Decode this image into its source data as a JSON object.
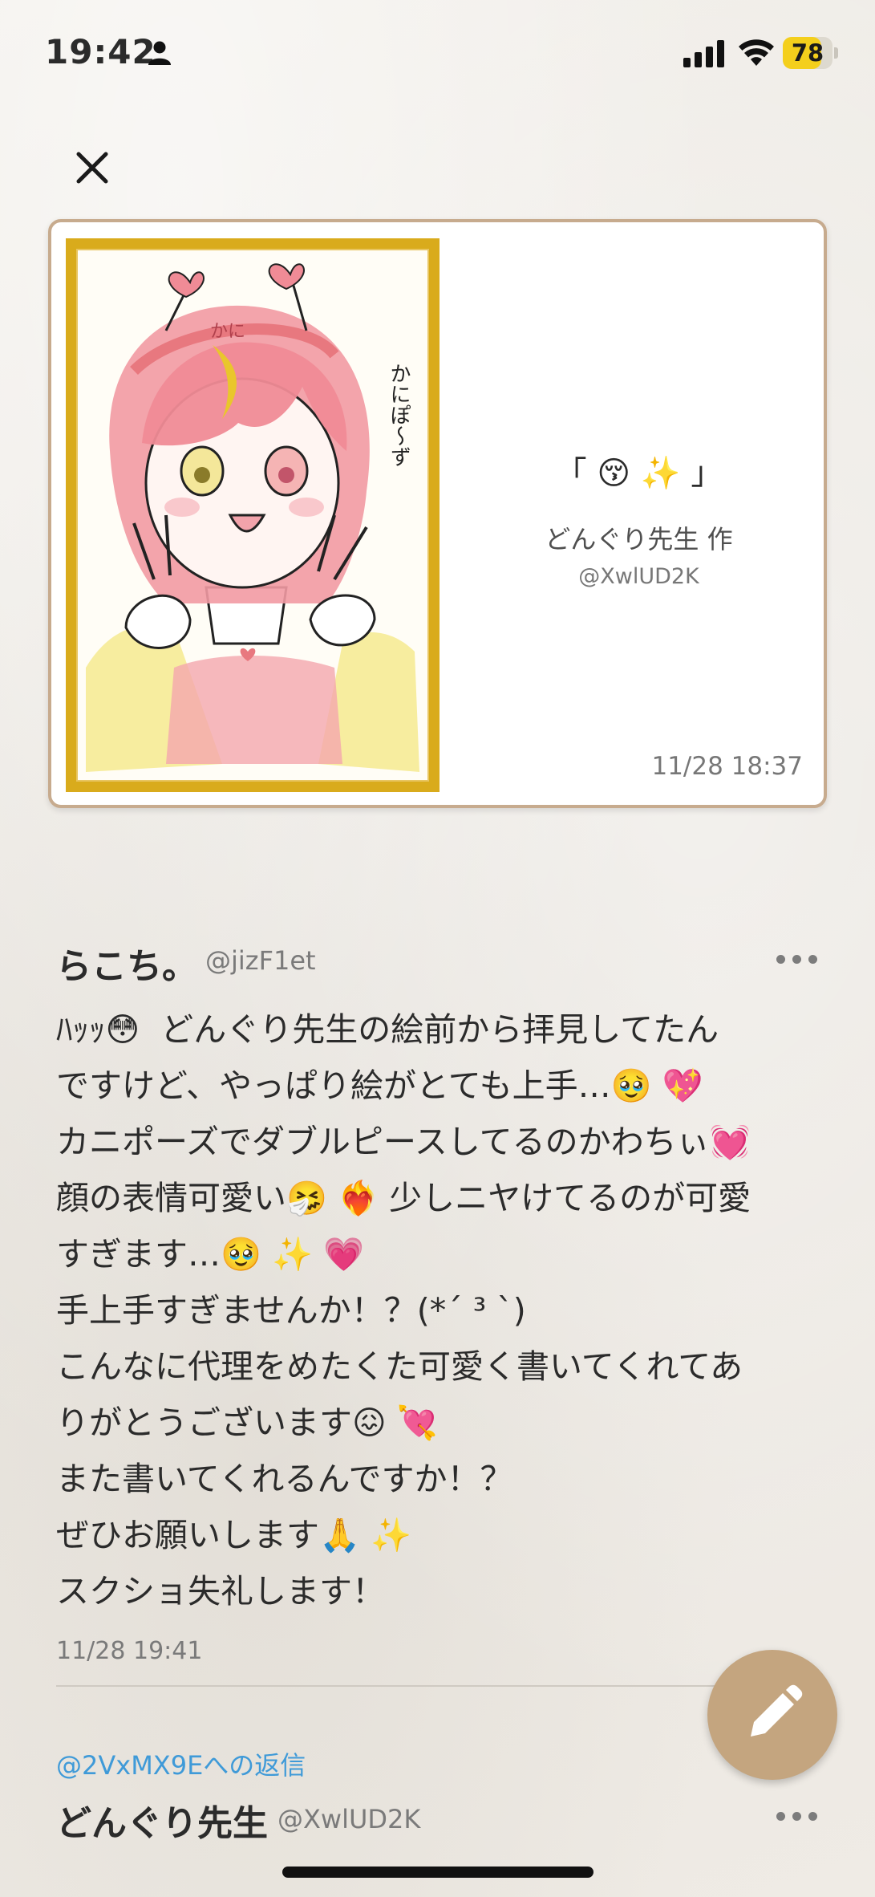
{
  "status_bar": {
    "time": "19:42",
    "battery": "78",
    "battery_level": 0.78,
    "battery_color": "#f4cf1c"
  },
  "card": {
    "title": "「 😚 ✨ 」",
    "author": "どんぐり先生 作",
    "handle": "@XwlUD2K",
    "date": "11/28 18:37",
    "artwork_caption": "かにぽ〜ず",
    "artwork_headband": "かに",
    "frame_color": "#d9ab1c",
    "border_color": "#c7ab8e"
  },
  "post": {
    "name": "らこち。",
    "handle": "@jizF1et",
    "lines": [
      "ﾊｯｯ😳 ︎ どんぐり先生の絵前から拝見してたん",
      "ですけど、やっぱり絵がとても上手…🥹 💖",
      "カニポーズでダブルピースしてるのかわちぃ💓",
      "顔の表情可愛い🤧 ❤️‍🔥 少しニヤけてるのが可愛",
      "すぎます…🥹 ✨ 💗",
      "手上手すぎませんか！？(*´ ³ `)",
      "こんなに代理をめたくた可愛く書いてくれてあ",
      "りがとうございます😖 💘",
      "また書いてくれるんですか！？",
      "ぜひお願いします🙏 ✨",
      "スクショ失礼します！"
    ],
    "date": "11/28 19:41"
  },
  "reply": {
    "reply_to": "@2VxMX9Eへの返信",
    "name": "どんぐり先生",
    "handle": "@XwlUD2K"
  },
  "icons": {
    "close": "close-icon",
    "more": "more-icon",
    "compose": "pencil-icon"
  },
  "colors": {
    "link": "#3f9ad8",
    "fab": "#c4a57f"
  }
}
